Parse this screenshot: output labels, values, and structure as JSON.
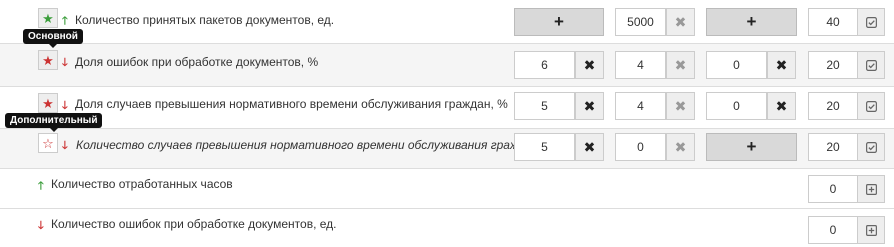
{
  "rows": [
    {
      "star": "★",
      "arrow": "🡑",
      "label": "Количество принятых пакетов документов, ед.",
      "plus1": "+",
      "value2": "5000",
      "x2": "✖",
      "plus3": "+",
      "value4": "40"
    },
    {
      "tooltip": "Основной",
      "star": "★",
      "arrow": "🡓",
      "label": "Доля ошибок при обработке документов, %",
      "value1": "6",
      "x1": "✖",
      "value2": "4",
      "x2": "✖",
      "value3": "0",
      "x3": "✖",
      "value4": "20"
    },
    {
      "star": "★",
      "arrow": "🡓",
      "label": "Доля случаев превышения нормативного времени обслуживания граждан, %",
      "value1": "5",
      "x1": "✖",
      "value2": "4",
      "x2": "✖",
      "value3": "0",
      "x3": "✖",
      "value4": "20"
    },
    {
      "tooltip": "Дополнительный",
      "star": "☆",
      "arrow": "🡓",
      "label": "Количество случаев превышения нормативного времени обслуживания граждан, ед.",
      "value1": "5",
      "x1": "✖",
      "value2": "0",
      "x2": "✖",
      "plus3": "+",
      "value4": "20"
    },
    {
      "arrow": "🡑",
      "label": "Количество отработанных часов",
      "value4": "0"
    },
    {
      "arrow": "🡓",
      "label": "Количество ошибок при обработке документов, ед.",
      "value4": "0"
    }
  ],
  "icons": {
    "star": "star-icon",
    "star_outline": "star-outline-icon",
    "arrow_up": "arrow-up-icon",
    "arrow_down": "arrow-down-icon",
    "remove": "close-icon",
    "confirm": "checkbox-check-icon",
    "expand": "plus-square-icon"
  },
  "colors": {
    "up": "#3c9e3c",
    "down": "#cc3333",
    "tooltip_bg": "#111111",
    "alt_row": "#f5f5f5"
  }
}
